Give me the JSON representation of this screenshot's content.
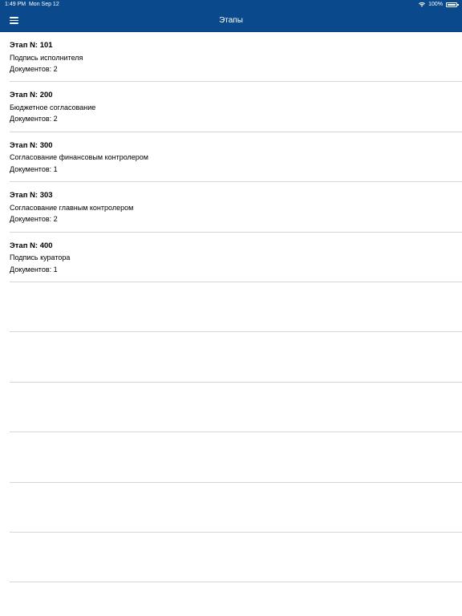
{
  "status_bar": {
    "time": "1:49 PM",
    "date": "Mon Sep 12",
    "battery_text": "100%",
    "battery_level": 1.0
  },
  "nav": {
    "title": "Этапы",
    "menu_icon": "hamburger-menu-icon"
  },
  "stages": [
    {
      "title": "Этап N: 101",
      "subtitle": "Подпись исполнителя",
      "documents": "Документов: 2"
    },
    {
      "title": "Этап N: 200",
      "subtitle": "Бюджетное согласование",
      "documents": "Документов: 2"
    },
    {
      "title": "Этап N: 300",
      "subtitle": "Согласование финансовым контролером",
      "documents": "Документов: 1"
    },
    {
      "title": "Этап N: 303",
      "subtitle": "Согласование главным контролером",
      "documents": "Документов: 2"
    },
    {
      "title": "Этап N: 400",
      "subtitle": "Подпись куратора",
      "documents": "Документов: 1"
    }
  ],
  "colors": {
    "nav_background": "#0a4a8c",
    "separator": "#d6d6d6"
  }
}
